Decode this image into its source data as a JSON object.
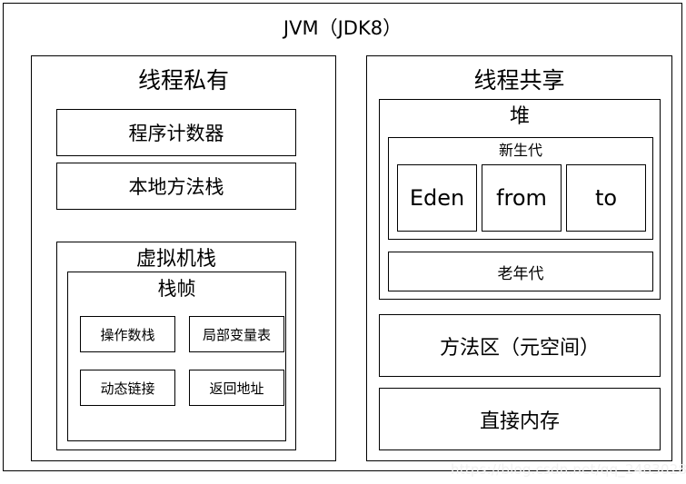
{
  "diagram": {
    "title": "JVM（JDK8）",
    "watermark": "https://blog.csdn.net/qq_24830283"
  },
  "thread_private": {
    "title": "线程私有",
    "pc_register": "程序计数器",
    "native_method_stack": "本地方法栈",
    "vm_stack": {
      "title": "虚拟机栈",
      "stack_frame": {
        "title": "栈帧",
        "cells": [
          {
            "label": "操作数栈"
          },
          {
            "label": "局部变量表"
          },
          {
            "label": "动态链接"
          },
          {
            "label": "返回地址"
          }
        ]
      }
    }
  },
  "thread_shared": {
    "title": "线程共享",
    "heap": {
      "title": "堆",
      "young_generation": {
        "title": "新生代",
        "regions": [
          {
            "label": "Eden"
          },
          {
            "label": "from"
          },
          {
            "label": "to"
          }
        ]
      },
      "old_generation": "老年代"
    },
    "method_area": "方法区（元空间）",
    "direct_memory": "直接内存"
  },
  "colors": {
    "background": "#ffffff",
    "stroke": "#000000",
    "text": "#000000",
    "watermark": "#f2f2f2"
  }
}
